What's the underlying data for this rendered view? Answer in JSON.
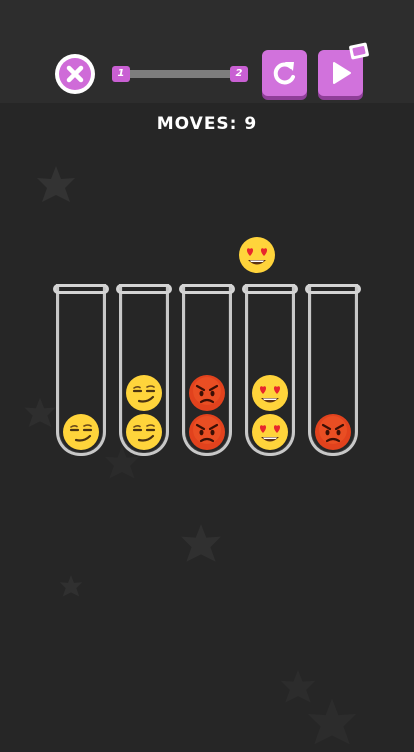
{
  "header": {
    "level_start": "1",
    "level_end": "2",
    "progress": 0
  },
  "moves": "MOVES: 9",
  "tubes": [
    {
      "balls": [
        "smirk"
      ]
    },
    {
      "balls": [
        "smirk",
        "smirk"
      ]
    },
    {
      "balls": [
        "angry",
        "angry"
      ]
    },
    {
      "balls": [
        "heart-eyes",
        "heart-eyes"
      ]
    },
    {
      "balls": [
        "angry"
      ]
    }
  ],
  "held_ball": {
    "type": "heart-eyes",
    "above_tube": 4
  },
  "colors": {
    "accent": "#cf6bd8",
    "background": "#262626",
    "emoji_yellow": "#ffd43b",
    "emoji_red": "#e2421d"
  }
}
